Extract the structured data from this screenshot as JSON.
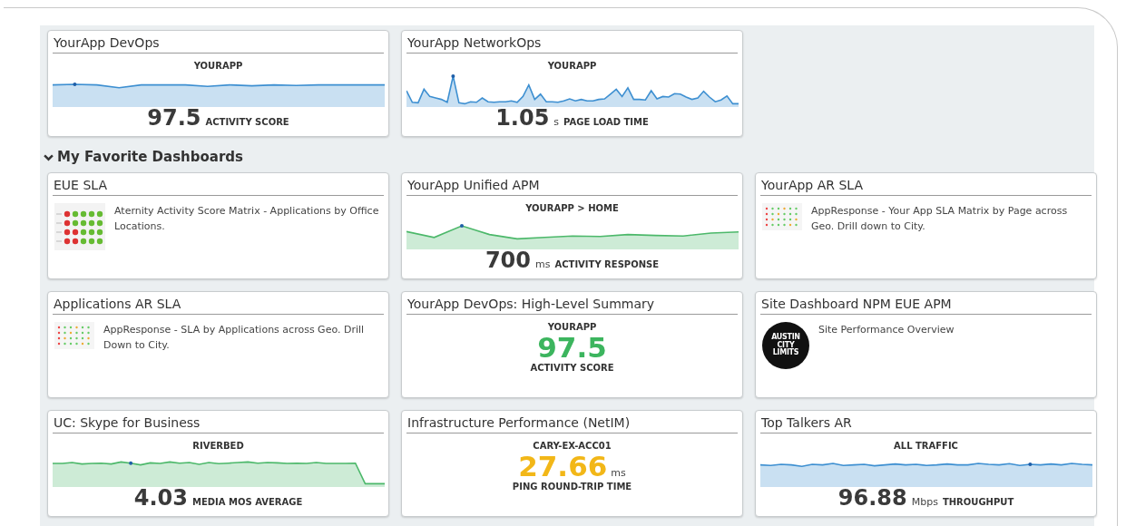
{
  "top_widgets": [
    {
      "kind": "sparkline",
      "title": "YourApp DevOps",
      "subtitle": "YOURAPP",
      "value": "97.5",
      "metric": "ACTIVITY SCORE",
      "color": "#3d8fd1"
    },
    {
      "kind": "sparkline",
      "title": "YourApp NetworkOps",
      "subtitle": "YOURAPP",
      "value": "1.05",
      "unit": "s",
      "metric": "PAGE LOAD TIME",
      "color": "#3d8fd1"
    }
  ],
  "section": {
    "title": "My Favorite Dashboards",
    "expanded": true
  },
  "widgets": [
    {
      "kind": "description",
      "title": "EUE SLA",
      "text": "Aternity Activity Score Matrix - Applications by Office Locations.",
      "thumbnail": {
        "kind": "dot-matrix"
      }
    },
    {
      "kind": "sparkline",
      "title": "YourApp Unified APM",
      "subtitle": "YOURAPP > HOME",
      "value": "700",
      "unit": "ms",
      "metric": "ACTIVITY RESPONSE",
      "color": "#4cb86a"
    },
    {
      "kind": "description",
      "title": "YourApp AR SLA",
      "text": "AppResponse - Your App SLA Matrix by Page across Geo. Drill down to City.",
      "thumbnail": {
        "kind": "small-matrix"
      }
    },
    {
      "kind": "description",
      "title": "Applications AR SLA",
      "text": "AppResponse - SLA by Applications across Geo. Drill Down to City.",
      "thumbnail": {
        "kind": "small-matrix"
      }
    },
    {
      "kind": "number",
      "title": "YourApp DevOps: High-Level Summary",
      "subtitle": "YOURAPP",
      "value": "97.5",
      "metric": "ACTIVITY SCORE",
      "color": "#3cb55e"
    },
    {
      "kind": "description",
      "title": "Site Dashboard NPM EUE APM",
      "text": "Site Performance Overview",
      "thumbnail": {
        "kind": "logo",
        "lines": [
          "AUSTIN",
          "CITY",
          "LIMITS"
        ]
      }
    },
    {
      "kind": "sparkline",
      "title": "UC: Skype for Business",
      "subtitle": "RIVERBED",
      "value": "4.03",
      "metric": "MEDIA MOS AVERAGE",
      "color": "#4cb86a"
    },
    {
      "kind": "number",
      "title": "Infrastructure Performance (NetIM)",
      "subtitle": "CARY-EX-ACC01",
      "value": "27.66",
      "unit": "ms",
      "metric": "PING ROUND-TRIP TIME",
      "color": "#f2b718"
    },
    {
      "kind": "sparkline",
      "title": "Top Talkers AR",
      "subtitle": "ALL TRAFFIC",
      "value": "96.88",
      "unit": "Mbps",
      "metric": "THROUGHPUT",
      "color": "#3d8fd1"
    }
  ]
}
